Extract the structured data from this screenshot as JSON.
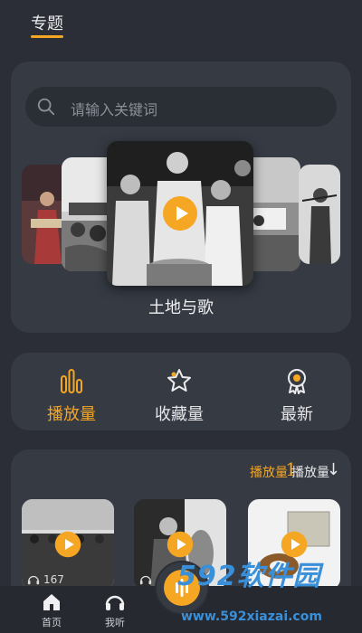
{
  "header": {
    "title": "专题"
  },
  "search": {
    "placeholder": "请输入关键词"
  },
  "carousel": {
    "caption": "土地与歌",
    "items": [
      "stage-performer",
      "crowd-banner",
      "singing-crowd",
      "banner-scene",
      "flute-player"
    ]
  },
  "filters": [
    {
      "label": "播放量",
      "icon": "bar-chart-icon",
      "active": true
    },
    {
      "label": "收藏量",
      "icon": "star-icon",
      "active": false
    },
    {
      "label": "最新",
      "icon": "award-icon",
      "active": false
    }
  ],
  "sort": {
    "primary_label": "播放量",
    "primary_value": "1",
    "secondary_label": "播放量",
    "secondary_icon": "sort-down-arrow"
  },
  "list": {
    "items": [
      {
        "play_count": "167",
        "icon": "headphones-icon"
      },
      {
        "play_count": "",
        "icon": "headphones-icon"
      },
      {
        "play_count": "",
        "icon": "headphones-icon"
      }
    ]
  },
  "tabbar": {
    "items": [
      {
        "label": "首页",
        "icon": "home-icon"
      },
      {
        "label": "我听",
        "icon": "headphones-icon"
      }
    ]
  },
  "watermark": {
    "logo": "592软件园",
    "url": "www.592xiazai.com"
  },
  "colors": {
    "accent": "#f5a623",
    "background": "#2b2e36",
    "card": "#353a43",
    "watermark": "#3a8fd9"
  }
}
